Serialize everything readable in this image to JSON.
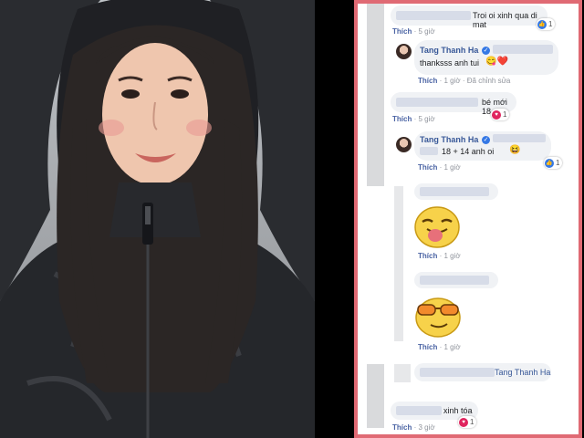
{
  "comments": [
    {
      "text": "Troi oi xinh qua di mat",
      "time": "5 giờ",
      "reaction_count": "1"
    },
    {
      "author": "Tang Thanh Ha",
      "text": "thanksss anh tui",
      "time": "1 giờ",
      "edited": "Đã chỉnh sửa"
    },
    {
      "text": "bé mới 18",
      "time": "5 giờ",
      "reaction_count": "1"
    },
    {
      "author": "Tang Thanh Ha",
      "text": "18 + 14 anh oi",
      "time": "1 giờ",
      "reaction_count": "1"
    },
    {
      "time": "1 giờ"
    },
    {
      "time": "1 giờ"
    },
    {
      "mention": "Tang Thanh Ha",
      "time": "",
      "reaction_count": ""
    },
    {
      "text": "xinh tóa",
      "time": "3 giờ",
      "reaction_count": "1"
    }
  ],
  "ui": {
    "like_label": "Thích",
    "dot": "·"
  },
  "colors": {
    "frame": "#e06a74",
    "link": "#385898",
    "like": "#3578e5",
    "love": "#e0245e"
  },
  "icons": [
    "verified-badge-icon",
    "like-reaction-icon",
    "love-reaction-icon",
    "tongue-emoji-sticker",
    "sunglasses-emoji-sticker"
  ]
}
